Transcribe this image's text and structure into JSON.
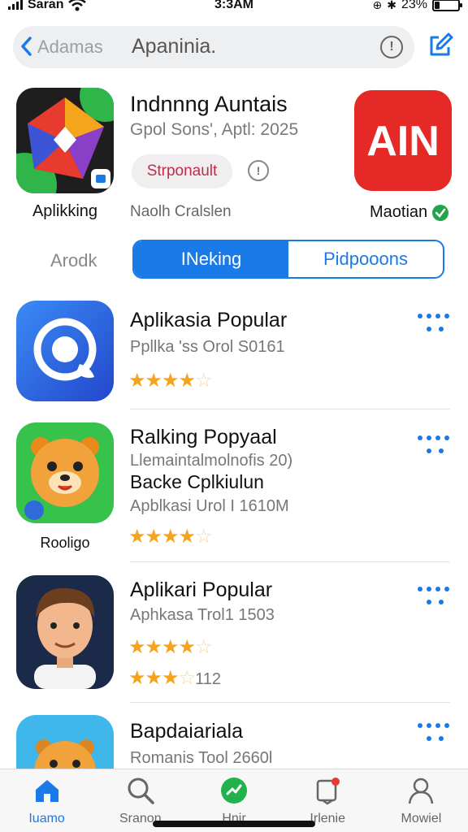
{
  "status_bar": {
    "carrier": "Saran",
    "time": "3:3AM",
    "battery_text": "23%",
    "battery_level": 0.23
  },
  "search": {
    "back_label": "Adamas",
    "title": "Apaninia."
  },
  "featured": {
    "left_app_label": "Aplikking",
    "title": "Indnnng Auntais",
    "subtitle": "Gpol Sons', Aptl: 2025",
    "chip_label": "Strponault",
    "description": "Naolh Cralslen",
    "right_app_label": "Maotian",
    "right_icon_text": "AIN"
  },
  "segments": {
    "left_label": "Arodk",
    "items": [
      "INeking",
      "Pidpooons"
    ],
    "active_index": 0
  },
  "apps": [
    {
      "title": "Aplikasia Popular",
      "subtitle": "Ppllka 'ss Orol S0161",
      "stars": "★★★★",
      "star_empty": "☆",
      "rating": 4
    },
    {
      "title": "Ralking Popyaal",
      "subtitle": "Llemaintalmolnofis 20)",
      "subtitle2": "Backe Cplkiulun",
      "subtitle3": "Apblkasi Urol I 1610M",
      "stars": "★★★★",
      "star_empty": "☆",
      "rating": 4,
      "label_under": "Rooligo"
    },
    {
      "title": "Aplikari Popular",
      "subtitle": "Aphkasa Trol1 1503",
      "stars": "★★★★",
      "star_empty": "☆",
      "rating": 4,
      "stars2": "★★★",
      "star_half2": "☆",
      "rating2_text": "112"
    },
    {
      "title": "Bapdaiariala",
      "subtitle": "Romanis Tool 2660l"
    }
  ],
  "tabs": [
    {
      "label": "Iuamo",
      "icon": "home-icon"
    },
    {
      "label": "Sranon",
      "icon": "search-icon"
    },
    {
      "label": "Hnir",
      "icon": "chat-icon"
    },
    {
      "label": "Irlenie",
      "icon": "notification-icon"
    },
    {
      "label": "Mowiel",
      "icon": "profile-icon"
    }
  ],
  "colors": {
    "accent": "#1a7ae8",
    "star": "#f5a31b",
    "chip_text": "#c12c4c",
    "verified": "#24a44a",
    "red_icon": "#e42927"
  }
}
